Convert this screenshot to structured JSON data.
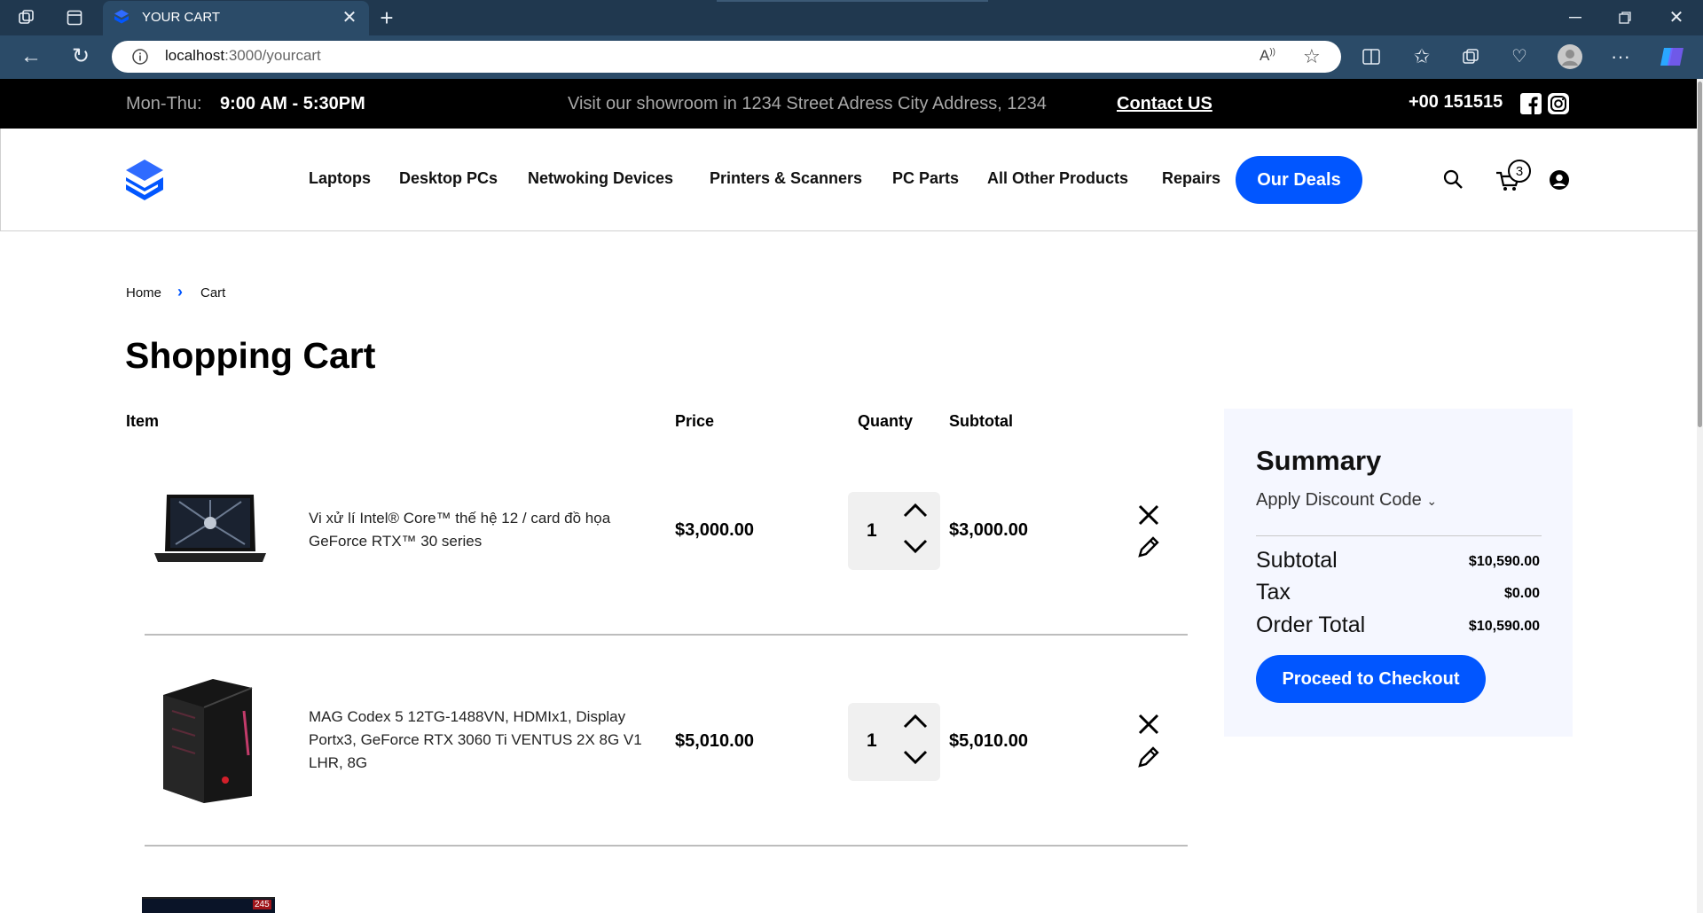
{
  "browser": {
    "tab_title": "YOUR CART",
    "url_host": "localhost",
    "url_rest": ":3000/yourcart"
  },
  "infobar": {
    "hours_label": "Mon-Thu:",
    "hours_value": "9:00 AM - 5:30PM",
    "showroom_text": "Visit our showroom in 1234 Street Adress City Address, 1234",
    "contact_link": "Contact US",
    "phone": "+00 151515"
  },
  "nav": {
    "items": [
      "Laptops",
      "Desktop PCs",
      "Netwoking Devices",
      "Printers & Scanners",
      "PC Parts",
      "All Other Products",
      "Repairs"
    ],
    "deals": "Our Deals",
    "cart_count": "3"
  },
  "breadcrumb": {
    "home": "Home",
    "current": "Cart"
  },
  "page_title": "Shopping Cart",
  "table_headers": {
    "item": "Item",
    "price": "Price",
    "quantity": "Quanty",
    "subtotal": "Subtotal"
  },
  "cart_items": [
    {
      "description": "Vi xử lí Intel® Core™ thế hệ 12 / card đồ họa GeForce RTX™ 30 series",
      "price": "$3,000.00",
      "quantity": "1",
      "subtotal": "$3,000.00"
    },
    {
      "description": "MAG Codex 5 12TG-1488VN, HDMIx1, Display Portx3, GeForce RTX 3060 Ti VENTUS 2X 8G V1 LHR, 8G",
      "price": "$5,010.00",
      "quantity": "1",
      "subtotal": "$5,010.00"
    }
  ],
  "partial_item_badge": "245",
  "summary": {
    "title": "Summary",
    "discount": "Apply Discount Code",
    "subtotal_label": "Subtotal",
    "subtotal_value": "$10,590.00",
    "tax_label": "Tax",
    "tax_value": "$0.00",
    "total_label": "Order Total",
    "total_value": "$10,590.00",
    "checkout": "Proceed to Checkout"
  },
  "colors": {
    "accent": "#0156ff",
    "chrome_dark": "#20384f",
    "chrome_mid": "#2b4b68"
  }
}
